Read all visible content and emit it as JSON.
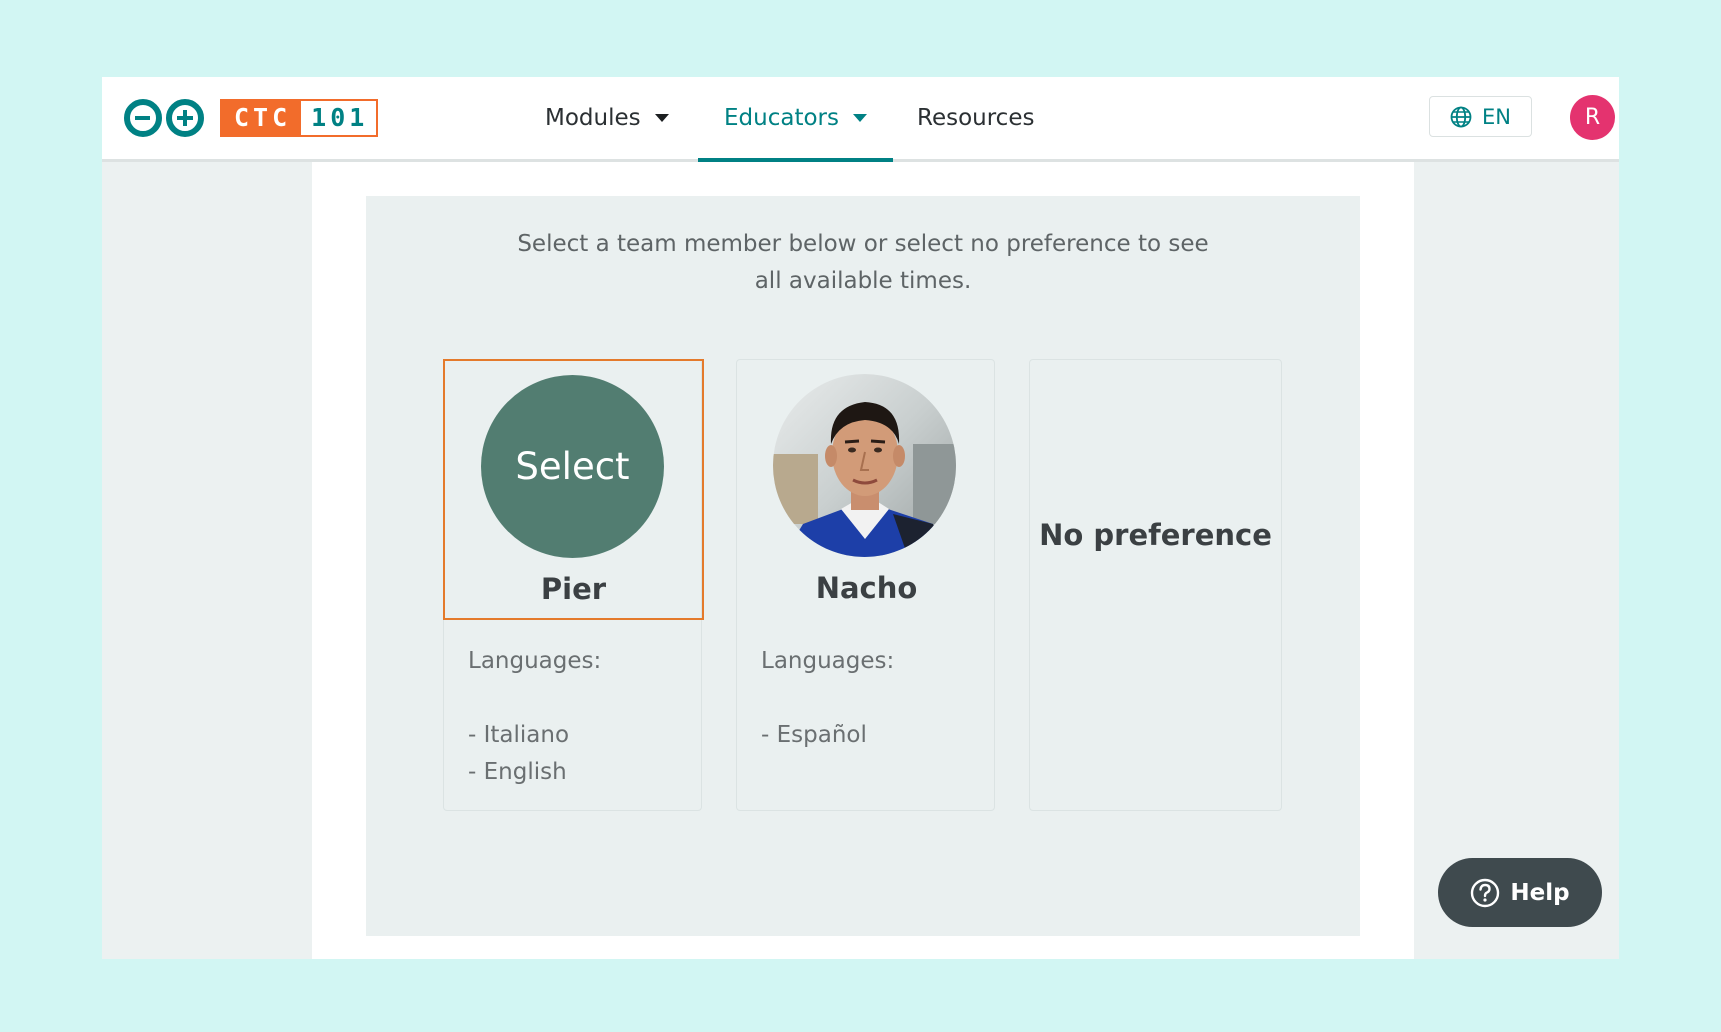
{
  "brand": {
    "logo_ctc": "CTC",
    "logo_101": "101"
  },
  "nav": {
    "items": [
      {
        "label": "Modules",
        "has_dropdown": true,
        "active": false
      },
      {
        "label": "Educators",
        "has_dropdown": true,
        "active": true
      },
      {
        "label": "Resources",
        "has_dropdown": false,
        "active": false
      }
    ],
    "language": "EN",
    "avatar_initial": "R"
  },
  "content": {
    "instructions": "Select a team member below or select no preference to see all available times.",
    "members": [
      {
        "name": "Pier",
        "overlay_label": "Select",
        "selected": true,
        "languages_heading": "Languages:",
        "languages": [
          "- Italiano",
          "- English"
        ]
      },
      {
        "name": "Nacho",
        "selected": false,
        "languages_heading": "Languages:",
        "languages": [
          "- Español"
        ]
      }
    ],
    "no_preference_label": "No preference"
  },
  "help": {
    "label": "Help"
  },
  "colors": {
    "background": "#d2f6f3",
    "brand_teal": "#008184",
    "brand_orange": "#f26c2b",
    "select_green": "#527d71",
    "avatar_pink": "#e4336f",
    "help_dark": "#3f4a4e"
  }
}
